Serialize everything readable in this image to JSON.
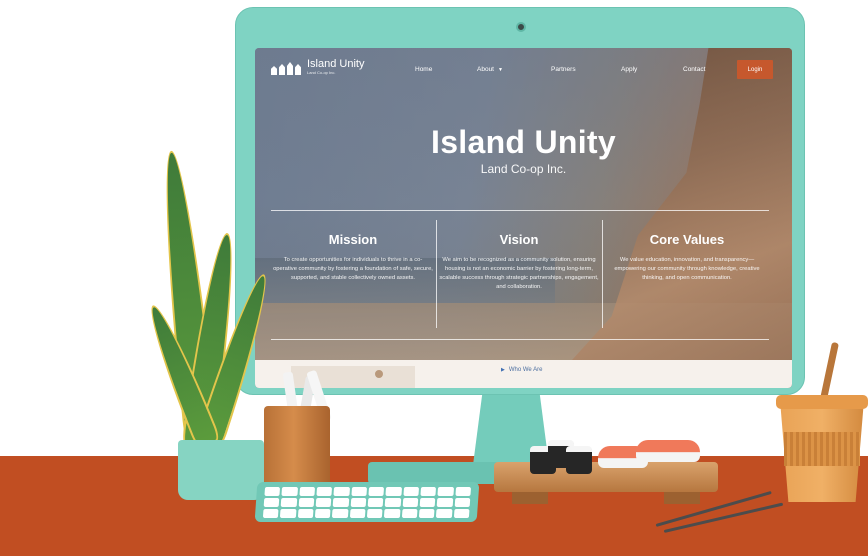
{
  "site": {
    "logo": {
      "name": "Island Unity",
      "subtitle": "Land Co-op Inc."
    },
    "nav": {
      "home": "Home",
      "about": "About",
      "partners": "Partners",
      "apply": "Apply",
      "contact": "Contact",
      "login": "Login"
    },
    "hero": {
      "title": "Island Unity",
      "subtitle": "Land Co-op Inc."
    },
    "columns": [
      {
        "heading": "Mission",
        "body": "To create opportunities for individuals to thrive in a co-operative community by fostering a foundation of safe, secure, supported, and stable collectively owned assets."
      },
      {
        "heading": "Vision",
        "body": "We aim to be recognized as a community solution, ensuring housing is not an economic barrier by fostering long-term, scalable success through strategic partnerships, engagement, and collaboration."
      },
      {
        "heading": "Core Values",
        "body": "We value education, innovation, and transparency—empowering our community through knowledge, creative thinking, and open communication."
      }
    ],
    "section_link": "Who We Are"
  },
  "colors": {
    "monitor": "#7fd3c3",
    "desk": "#c14e22",
    "login_button": "#c6582d"
  },
  "icons": [
    "logo-houses-icon",
    "chevron-down-icon",
    "play-triangle-icon",
    "camera-icon"
  ]
}
